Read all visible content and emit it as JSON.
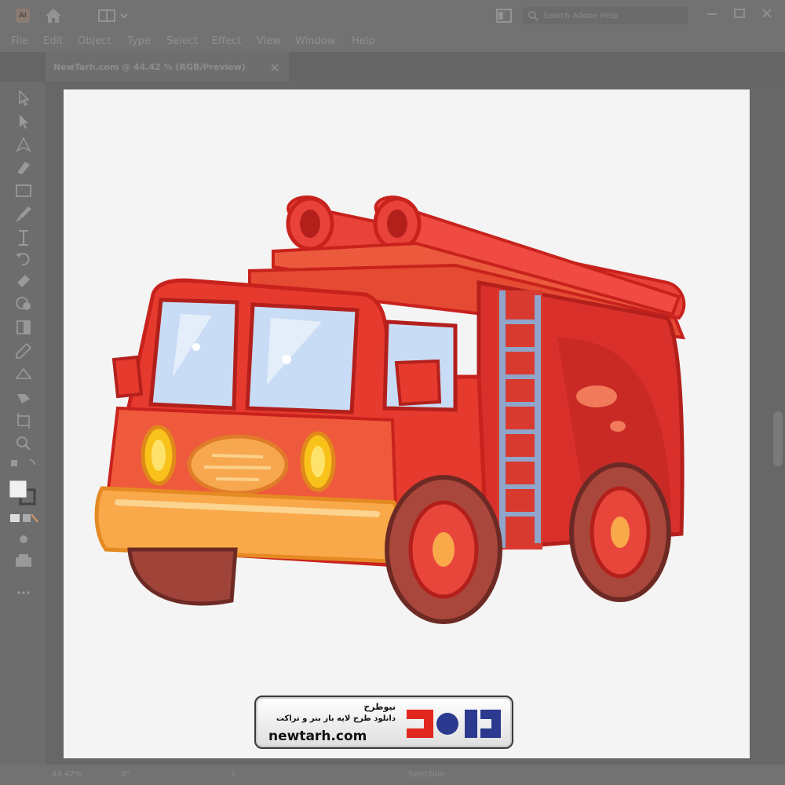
{
  "app": {
    "logo_text": "Ai",
    "search_placeholder": "Search Adobe Help"
  },
  "menu": {
    "items": [
      "File",
      "Edit",
      "Object",
      "Type",
      "Select",
      "Effect",
      "View",
      "Window",
      "Help"
    ]
  },
  "document": {
    "tab_title": "NewTarh.com @ 44.42 % (RGB/Preview)"
  },
  "status": {
    "zoom": "44.42%",
    "rotation": "0°",
    "artboard": "1",
    "tool": "Selection"
  },
  "watermark": {
    "title_fa": "نیوطرح",
    "subtitle_fa": "دانلود طرح لایه باز بنر و تراکت",
    "site": "newtarh.com",
    "mark_fa": "نیوطرح"
  },
  "colors": {
    "chrome": "#727272",
    "artboard": "#f4f4f4",
    "truck_red": "#e5322d",
    "bumper": "#f9a94a",
    "glass": "#c9dcf5"
  },
  "icons": [
    "home-icon",
    "workspace-icon",
    "arrange-icon",
    "search-icon",
    "minimize-icon",
    "maximize-icon",
    "close-icon"
  ]
}
